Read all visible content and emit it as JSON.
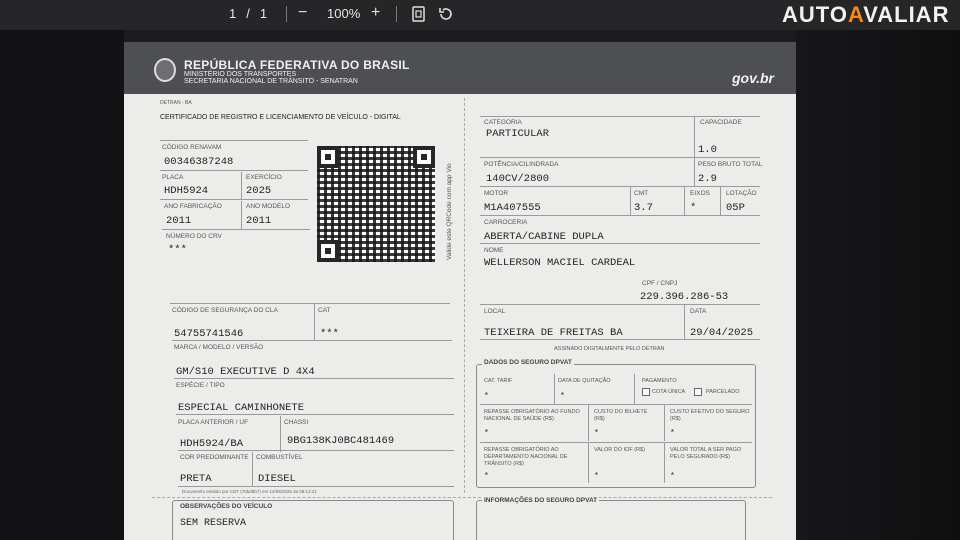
{
  "viewer": {
    "page_current": "1",
    "page_sep": "/",
    "page_total": "1",
    "zoom_out": "−",
    "zoom": "100%",
    "zoom_in": "+",
    "brand_a": "AUTO",
    "brand_b": "A",
    "brand_c": "VALIAR"
  },
  "header": {
    "title": "REPÚBLICA FEDERATIVA DO BRASIL",
    "ministry": "MINISTÉRIO DOS TRANSPORTES",
    "secretariat": "SECRETARIA NACIONAL DE TRÂNSITO - SENATRAN",
    "govbr": "gov.br"
  },
  "left": {
    "detran": "DETRAN - BA",
    "doc_title": "CERTIFICADO DE REGISTRO E LICENCIAMENTO DE VEÍCULO - DIGITAL",
    "renavam_label": "CÓDIGO RENAVAM",
    "renavam": "00346387248",
    "placa_label": "PLACA",
    "placa": "HDH5924",
    "exercicio_label": "EXERCÍCIO",
    "exercicio": "2025",
    "ano_fab_label": "ANO FABRICAÇÃO",
    "ano_fab": "2011",
    "ano_mod_label": "ANO MODELO",
    "ano_mod": "2011",
    "crv_label": "NÚMERO DO CRV",
    "crv": "***",
    "qr_text": "Valide este QRCode com app Vio",
    "seg_cla_label": "CÓDIGO DE SEGURANÇA DO CLA",
    "seg_cla": "54755741546",
    "cat_label": "CAT",
    "cat": "***",
    "marca_label": "MARCA / MODELO / VERSÃO",
    "marca": "GM/S10 EXECUTIVE D 4X4",
    "especie_label": "ESPÉCIE / TIPO",
    "especie": "ESPECIAL CAMINHONETE",
    "placa_ant_label": "PLACA ANTERIOR / UF",
    "placa_ant": "HDH5924/BA",
    "chassi_label": "CHASSI",
    "chassi": "9BG138KJ0BC481469",
    "cor_label": "COR PREDOMINANTE",
    "cor": "PRETA",
    "comb_label": "COMBUSTÍVEL",
    "comb": "DIESEL",
    "footnote": "Documento emitido por CDT (75bd5b7) em 14/05/2025 às 08:13:21",
    "obs_title": "OBSERVAÇÕES DO VEÍCULO",
    "obs": "SEM RESERVA"
  },
  "right": {
    "categoria_label": "CATEGORIA",
    "categoria": "PARTICULAR",
    "capacidade_label": "CAPACIDADE",
    "capacidade": "1.0",
    "potencia_label": "POTÊNCIA/CILINDRADA",
    "potencia": "140CV/2800",
    "peso_label": "PESO BRUTO TOTAL",
    "peso": "2.9",
    "motor_label": "MOTOR",
    "motor": "M1A407555",
    "cmt_label": "CMT",
    "cmt": "3.7",
    "eixos_label": "EIXOS",
    "eixos": "*",
    "lotacao_label": "LOTAÇÃO",
    "lotacao": "05P",
    "carroceria_label": "CARROCERIA",
    "carroceria": "ABERTA/CABINE DUPLA",
    "nome_label": "NOME",
    "nome": "WELLERSON MACIEL CARDEAL",
    "cpf_label": "CPF / CNPJ",
    "cpf": "229.396.286-53",
    "local_label": "LOCAL",
    "local": "TEIXEIRA DE FREITAS BA",
    "data_label": "DATA",
    "data": "29/04/2025",
    "assinado": "ASSINADO DIGITALMENTE PELO DETRAN",
    "dpvat_title": "DADOS DO SEGURO DPVAT",
    "cat_tarif_label": "CAT. TARIF",
    "cat_tarif": "*",
    "data_quit_label": "DATA DE QUITAÇÃO",
    "data_quit": "*",
    "pagamento_label": "PAGAMENTO",
    "cota_unica": "COTA ÚNICA",
    "parcelado": "PARCELADO",
    "repasse_fns_label": "REPASSE OBRIGATÓRIO AO FUNDO NACIONAL DE SAÚDE (R$)",
    "repasse_fns": "*",
    "custo_bilhete_label": "CUSTO DO BILHETE (R$)",
    "custo_bilhete": "*",
    "custo_efetivo_label": "CUSTO EFETIVO DO SEGURO (R$)",
    "custo_efetivo": "*",
    "repasse_denatran_label": "REPASSE OBRIGATÓRIO AO DEPARTAMENTO NACIONAL DE TRÂNSITO (R$)",
    "repasse_denatran": "*",
    "valor_iof_label": "VALOR DO IOF (R$)",
    "valor_iof": "*",
    "valor_total_label": "VALOR TOTAL A SER PAGO PELO SEGURADO (R$)",
    "valor_total": "*",
    "info_title": "INFORMAÇÕES DO SEGURO DPVAT"
  }
}
